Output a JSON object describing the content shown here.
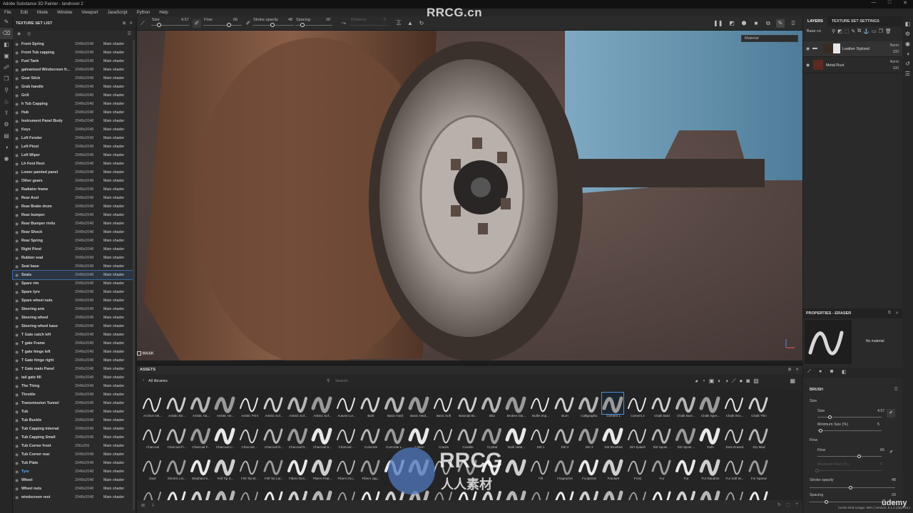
{
  "window": {
    "title": "Adobe Substance 3D Painter - landrover 2",
    "controls": [
      "—",
      "□",
      "✕"
    ]
  },
  "menu": [
    "File",
    "Edit",
    "Mode",
    "Window",
    "Viewport",
    "JavaScript",
    "Python",
    "Help"
  ],
  "watermark": {
    "logo_text": "RRCG.cn",
    "bottom_logo": "RRCG",
    "bottom_sub": "人人素材",
    "corner": "ūdemy"
  },
  "toolbar": {
    "size_label": "Size",
    "size_value": "4.57",
    "flow_label": "Flow",
    "flow_value": "66",
    "stroke_label": "Stroke opacity",
    "stroke_value": "48",
    "spacing_label": "Spacing",
    "spacing_value": "20",
    "distance_label": "Distance",
    "distance_value": "0",
    "size_level": 0.2,
    "flow_level": 0.66,
    "stroke_level": 0.48,
    "spacing_level": 0.2
  },
  "texture_set_list": {
    "title": "TEXTURE SET LIST",
    "rows": [
      {
        "name": "Front Spring",
        "res": "2048x2048",
        "shader": "Main shader"
      },
      {
        "name": "Front Tub capping",
        "res": "2048x2048",
        "shader": "Main shader"
      },
      {
        "name": "Fuel Tank",
        "res": "2048x2048",
        "shader": "Main shader"
      },
      {
        "name": "galvanized Windscreen fr...",
        "res": "2048x2048",
        "shader": "Main shader"
      },
      {
        "name": "Gear Stick",
        "res": "2048x2048",
        "shader": "Main shader"
      },
      {
        "name": "Grab handle",
        "res": "2048x2048",
        "shader": "Main shader"
      },
      {
        "name": "Grill",
        "res": "2048x2048",
        "shader": "Main shader"
      },
      {
        "name": "h Tub Capping",
        "res": "2048x2048",
        "shader": "Main shader"
      },
      {
        "name": "Hub",
        "res": "2048x2048",
        "shader": "Main shader"
      },
      {
        "name": "Instrument Panel Body",
        "res": "2048x2048",
        "shader": "Main shader"
      },
      {
        "name": "Keys",
        "res": "2048x2048",
        "shader": "Main shader"
      },
      {
        "name": "Left Fender",
        "res": "2048x2048",
        "shader": "Main shader"
      },
      {
        "name": "Left Pivot",
        "res": "2048x2048",
        "shader": "Main shader"
      },
      {
        "name": "Left Wiper",
        "res": "2048x2048",
        "shader": "Main shader"
      },
      {
        "name": "Lh Foot Rest",
        "res": "2048x2048",
        "shader": "Main shader"
      },
      {
        "name": "Lower painted panel",
        "res": "2048x2048",
        "shader": "Main shader"
      },
      {
        "name": "Other gears",
        "res": "2048x2048",
        "shader": "Main shader"
      },
      {
        "name": "Radiator frame",
        "res": "2048x2048",
        "shader": "Main shader"
      },
      {
        "name": "Rear Axel",
        "res": "2048x2048",
        "shader": "Main shader"
      },
      {
        "name": "Rear Brake drum",
        "res": "2048x2048",
        "shader": "Main shader"
      },
      {
        "name": "Rear bumper",
        "res": "2048x2048",
        "shader": "Main shader"
      },
      {
        "name": "Rear Bumper rivits",
        "res": "2048x2048",
        "shader": "Main shader"
      },
      {
        "name": "Rear Shock",
        "res": "2048x2048",
        "shader": "Main shader"
      },
      {
        "name": "Rear Spring",
        "res": "2048x2048",
        "shader": "Main shader"
      },
      {
        "name": "Right Pivot",
        "res": "2048x2048",
        "shader": "Main shader"
      },
      {
        "name": "Rubber seal",
        "res": "2048x2048",
        "shader": "Main shader"
      },
      {
        "name": "Seat base",
        "res": "2048x2048",
        "shader": "Main shader"
      },
      {
        "name": "Seats",
        "res": "2048x2048",
        "shader": "Main shader",
        "selected": true
      },
      {
        "name": "Spare rim",
        "res": "2048x2048",
        "shader": "Main shader"
      },
      {
        "name": "Spare tyre",
        "res": "2048x2048",
        "shader": "Main shader"
      },
      {
        "name": "Spare wheel nuts",
        "res": "2048x2048",
        "shader": "Main shader"
      },
      {
        "name": "Steering arm",
        "res": "2048x2048",
        "shader": "Main shader"
      },
      {
        "name": "Steering wheel",
        "res": "2048x2048",
        "shader": "Main shader"
      },
      {
        "name": "Steering wheel base",
        "res": "2048x2048",
        "shader": "Main shader"
      },
      {
        "name": "T Gate catch left",
        "res": "2048x2048",
        "shader": "Main shader"
      },
      {
        "name": "T gate Frame",
        "res": "2048x2048",
        "shader": "Main shader"
      },
      {
        "name": "T gate hinge left",
        "res": "2048x2048",
        "shader": "Main shader"
      },
      {
        "name": "T Gate hinge right",
        "res": "2048x2048",
        "shader": "Main shader"
      },
      {
        "name": "T Gate main Panel",
        "res": "2048x2048",
        "shader": "Main shader"
      },
      {
        "name": "tail gate fill",
        "res": "2048x2048",
        "shader": "Main shader"
      },
      {
        "name": "The Thing",
        "res": "2048x2048",
        "shader": "Main shader"
      },
      {
        "name": "Throttle",
        "res": "2048x2048",
        "shader": "Main shader"
      },
      {
        "name": "Transmission Tunnel",
        "res": "2048x2048",
        "shader": "Main shader"
      },
      {
        "name": "Tub",
        "res": "2048x2048",
        "shader": "Main shader"
      },
      {
        "name": "Tub Buckle",
        "res": "2048x2048",
        "shader": "Main shader"
      },
      {
        "name": "Tub Capping internal",
        "res": "2048x2048",
        "shader": "Main shader"
      },
      {
        "name": "Tub Capping Small",
        "res": "2048x2048",
        "shader": "Main shader"
      },
      {
        "name": "Tub Corner front",
        "res": "256x256",
        "shader": "Main shader"
      },
      {
        "name": "Tub Corner rear",
        "res": "2048x2048",
        "shader": "Main shader"
      },
      {
        "name": "Tub Plate",
        "res": "2048x2048",
        "shader": "Main shader"
      },
      {
        "name": "Tyre",
        "res": "2048x2048",
        "shader": "Main shader",
        "hover": true
      },
      {
        "name": "Wheel",
        "res": "2048x2048",
        "shader": "Main shader"
      },
      {
        "name": "Wheel nuts",
        "res": "2048x2048",
        "shader": "Main shader"
      },
      {
        "name": "windscreen rest",
        "res": "2048x2048",
        "shader": "Main shader"
      }
    ]
  },
  "viewport": {
    "material_mode": "Material",
    "mask_label": "MASK"
  },
  "assets": {
    "title": "ASSETS",
    "library": "All libraries",
    "search_placeholder": "Search",
    "brushes": [
      [
        "Archive Ink...",
        "Artistic Bri...",
        "Artistic Ha...",
        "Artistic He...",
        "Artistic Print",
        "Artistic Sof...",
        "Artistic Sof...",
        "Artistic Sof...",
        "Autumn Le...",
        "Bark",
        "Basic Hard",
        "Basic Hard...",
        "Basic Soft",
        "Basmati Br...",
        "Blur",
        "Broken Gla...",
        "Bullet Imp...",
        "Burn",
        "Calligraphic",
        "Cement 1",
        "Cement 2",
        "Chalk Bold",
        "Chalk Bum...",
        "Chalk Spre...",
        "Chalk Stro...",
        "Chalk Thin"
      ],
      [
        "Charcoal",
        "Charcoal Fi...",
        "Charcoal F...",
        "Charcoal Li...",
        "Charcoal ...",
        "Charcoal N...",
        "Charcoal R...",
        "Charcoal S...",
        "Charcoal ...",
        "Concrete",
        "Concrete L...",
        "Cotton",
        "Cracks",
        "Crackle",
        "Crystal",
        "Dark Hete...",
        "Dirt 1",
        "Dirt 2",
        "Dirt 3",
        "Dirt Brushed",
        "Dirt Splash",
        "Dirt Spots ...",
        "Dirt Spots ...",
        "Dots",
        "Dots Erased",
        "Dry Mud"
      ],
      [
        "Dust",
        "Electric Lin...",
        "Elephant S...",
        "Felt Tip S...",
        "Felt Tip W...",
        "Felt Tip Lar...",
        "Fibers Den...",
        "Fibers Feat...",
        "Fibers Imo...",
        "Fibers Jag...",
        "",
        "",
        "",
        "",
        "",
        "",
        "Fill",
        "Fingerprint",
        "Footprints",
        "Fracture",
        "Frost",
        "Fur",
        "Fur",
        "Fur Random",
        "Fur Soft W...",
        "Fur Sparse"
      ],
      [
        "",
        "",
        "",
        "",
        "",
        "",
        "",
        "",
        "",
        "",
        "",
        "",
        "",
        "",
        "",
        "",
        "",
        "",
        "",
        "",
        "",
        "",
        "",
        "",
        "",
        ""
      ]
    ]
  },
  "layers": {
    "tab_layers": "LAYERS",
    "tab_tss": "TEXTURE SET SETTINGS",
    "blend": "Base co",
    "items": [
      {
        "name": "Leather Stylized",
        "mode": "Norm",
        "opacity": "100"
      },
      {
        "name": "Metal Rust",
        "mode": "Norm",
        "opacity": "100"
      }
    ]
  },
  "properties": {
    "title": "PROPERTIES - ERASER",
    "no_material": "No material",
    "section": "BRUSH",
    "size_group": "Size",
    "size_label": "Size",
    "size_value": "4.57",
    "min_size_label": "Minimum Size (%)",
    "min_size_value": "5",
    "flow_group": "Flow",
    "flow_label": "Flow",
    "flow_value": "66",
    "min_flow_label": "Minimum Flow (%)",
    "min_flow_value": "0",
    "stroke_label": "Stroke opacity",
    "stroke_value": "48",
    "spacing_label": "Spacing",
    "spacing_value": "20",
    "size_level": 0.2,
    "min_size_level": 0.05,
    "flow_level": 0.66,
    "min_flow_level": 0.0,
    "stroke_level": 0.48,
    "spacing_level": 0.2
  },
  "status": {
    "cache": "Cache Disk Usage:  56% | Version: 9.1.2 (OpenGL)"
  }
}
